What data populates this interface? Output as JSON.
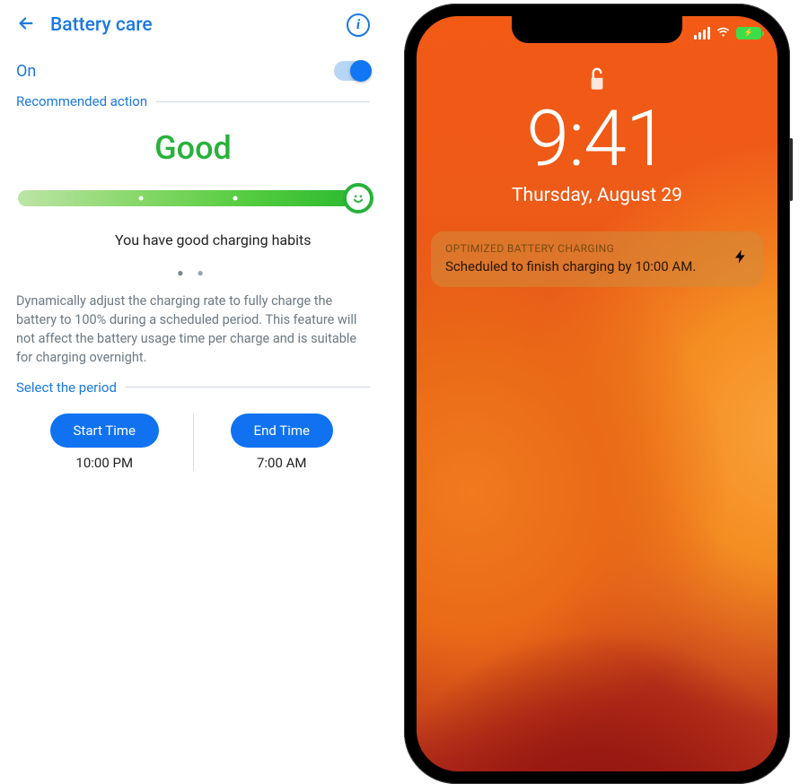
{
  "left": {
    "title": "Battery care",
    "on_label": "On",
    "toggle_on": true,
    "section_recommended": "Recommended action",
    "status_word": "Good",
    "habits_text": "You have good charging habits",
    "page_dots": "● ●",
    "description": "Dynamically adjust the charging rate to fully charge the battery to 100% during a scheduled period. This feature will not affect the battery usage time per charge and is suitable for charging overnight.",
    "section_period": "Select the period",
    "start_label": "Start Time",
    "start_value": "10:00 PM",
    "end_label": "End Time",
    "end_value": "7:00 AM"
  },
  "right": {
    "time": "9:41",
    "date": "Thursday, August 29",
    "notif_title": "OPTIMIZED BATTERY CHARGING",
    "notif_body": "Scheduled to finish charging by 10:00 AM."
  }
}
